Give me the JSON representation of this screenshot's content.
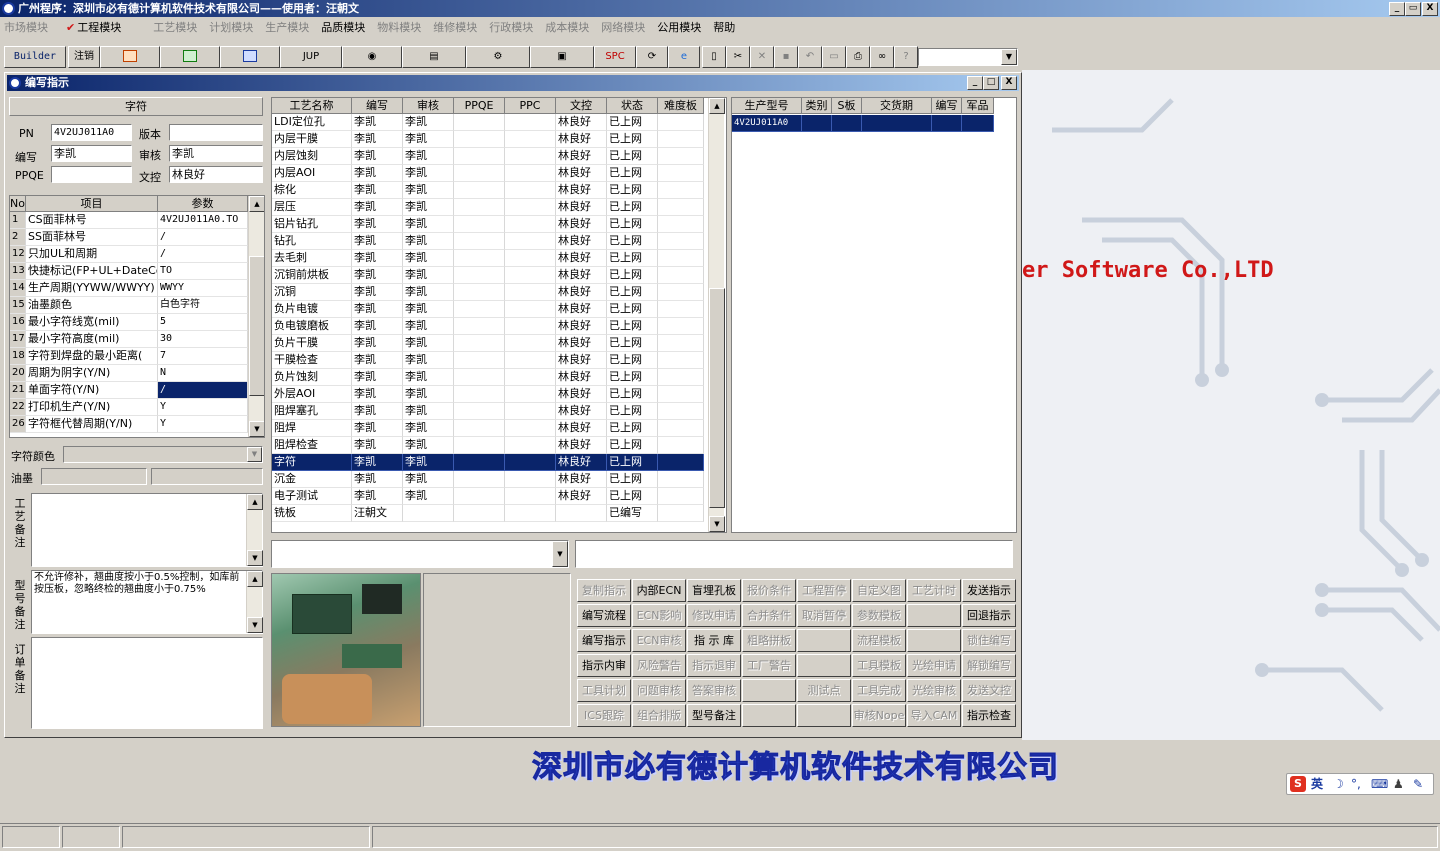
{
  "app": {
    "title": "广州程序：深圳市必有德计算机软件技术有限公司——使用者：汪朝文",
    "window_controls": [
      "_",
      "▭",
      "X"
    ]
  },
  "menu": [
    "市场模块",
    "工程模块",
    "工艺模块",
    "计划模块",
    "生产模块",
    "品质模块",
    "物料模块",
    "维修模块",
    "行政模块",
    "成本模块",
    "网络模块",
    "公用模块",
    "帮助"
  ],
  "toolbar": {
    "builder": "Builder",
    "logout": "注销",
    "jup": "JUP",
    "spc": "SPC"
  },
  "window": {
    "title": "编写指示",
    "controls": [
      "_",
      "□",
      "X"
    ]
  },
  "form": {
    "section_title": "字符",
    "pn_label": "PN",
    "pn_value": "4V2UJ011A0",
    "version_label": "版本",
    "version_value": "",
    "writer_label": "编写",
    "writer_value": "李凯",
    "reviewer_label": "审核",
    "reviewer_value": "李凯",
    "ppqe_label": "PPQE",
    "ppqe_value": "",
    "doc_label": "文控",
    "doc_value": "林良好"
  },
  "param_table": {
    "headers": [
      "No",
      "项目",
      "参数"
    ],
    "rows": [
      {
        "no": "1",
        "item": "CS面菲林号",
        "value": "4V2UJ011A0.TO"
      },
      {
        "no": "2",
        "item": "SS面菲林号",
        "value": "/"
      },
      {
        "no": "12",
        "item": "只加UL和周期",
        "value": "/"
      },
      {
        "no": "13",
        "item": "快捷标记(FP+UL+DateCo",
        "value": "TO"
      },
      {
        "no": "14",
        "item": "生产周期(YYWW/WWYY)",
        "value": "WWYY"
      },
      {
        "no": "15",
        "item": "油墨颜色",
        "value": "白色字符"
      },
      {
        "no": "16",
        "item": "最小字符线宽(mil)",
        "value": "5"
      },
      {
        "no": "17",
        "item": "最小字符高度(mil)",
        "value": "30"
      },
      {
        "no": "18",
        "item": "字符到焊盘的最小距离(",
        "value": "7"
      },
      {
        "no": "20",
        "item": "周期为阴字(Y/N)",
        "value": "N"
      },
      {
        "no": "21",
        "item": "单面字符(Y/N)",
        "value": "/"
      },
      {
        "no": "22",
        "item": "打印机生产(Y/N)",
        "value": "Y"
      },
      {
        "no": "26",
        "item": "字符框代替周期(Y/N)",
        "value": "Y"
      }
    ]
  },
  "char_color_label": "字符颜色",
  "ink_label": "油墨",
  "process_note_label": "工艺备注",
  "model_note_label": "型号备注",
  "model_note_text": "不允许修补，翘曲度按小于0.5%控制，如库前按压板，忽略终检的翘曲度小于0.75%",
  "order_note_label": "订单备注",
  "process_table": {
    "headers": [
      "工艺名称",
      "编写",
      "审核",
      "PPQE",
      "PPC",
      "文控",
      "状态",
      "难度板"
    ],
    "rows": [
      {
        "name": "LDI定位孔",
        "writer": "李凯",
        "reviewer": "李凯",
        "doc": "林良好",
        "status": "已上网"
      },
      {
        "name": "内层干膜",
        "writer": "李凯",
        "reviewer": "李凯",
        "doc": "林良好",
        "status": "已上网"
      },
      {
        "name": "内层蚀刻",
        "writer": "李凯",
        "reviewer": "李凯",
        "doc": "林良好",
        "status": "已上网"
      },
      {
        "name": "内层AOI",
        "writer": "李凯",
        "reviewer": "李凯",
        "doc": "林良好",
        "status": "已上网"
      },
      {
        "name": "棕化",
        "writer": "李凯",
        "reviewer": "李凯",
        "doc": "林良好",
        "status": "已上网"
      },
      {
        "name": "层压",
        "writer": "李凯",
        "reviewer": "李凯",
        "doc": "林良好",
        "status": "已上网"
      },
      {
        "name": "铝片钻孔",
        "writer": "李凯",
        "reviewer": "李凯",
        "doc": "林良好",
        "status": "已上网"
      },
      {
        "name": "钻孔",
        "writer": "李凯",
        "reviewer": "李凯",
        "doc": "林良好",
        "status": "已上网"
      },
      {
        "name": "去毛刺",
        "writer": "李凯",
        "reviewer": "李凯",
        "doc": "林良好",
        "status": "已上网"
      },
      {
        "name": "沉铜前烘板",
        "writer": "李凯",
        "reviewer": "李凯",
        "doc": "林良好",
        "status": "已上网"
      },
      {
        "name": "沉铜",
        "writer": "李凯",
        "reviewer": "李凯",
        "doc": "林良好",
        "status": "已上网"
      },
      {
        "name": "负片电镀",
        "writer": "李凯",
        "reviewer": "李凯",
        "doc": "林良好",
        "status": "已上网"
      },
      {
        "name": "负电镀磨板",
        "writer": "李凯",
        "reviewer": "李凯",
        "doc": "林良好",
        "status": "已上网"
      },
      {
        "name": "负片干膜",
        "writer": "李凯",
        "reviewer": "李凯",
        "doc": "林良好",
        "status": "已上网"
      },
      {
        "name": "干膜检查",
        "writer": "李凯",
        "reviewer": "李凯",
        "doc": "林良好",
        "status": "已上网"
      },
      {
        "name": "负片蚀刻",
        "writer": "李凯",
        "reviewer": "李凯",
        "doc": "林良好",
        "status": "已上网"
      },
      {
        "name": "外层AOI",
        "writer": "李凯",
        "reviewer": "李凯",
        "doc": "林良好",
        "status": "已上网"
      },
      {
        "name": "阻焊塞孔",
        "writer": "李凯",
        "reviewer": "李凯",
        "doc": "林良好",
        "status": "已上网"
      },
      {
        "name": "阻焊",
        "writer": "李凯",
        "reviewer": "李凯",
        "doc": "林良好",
        "status": "已上网"
      },
      {
        "name": "阻焊检查",
        "writer": "李凯",
        "reviewer": "李凯",
        "doc": "林良好",
        "status": "已上网"
      },
      {
        "name": "字符",
        "writer": "李凯",
        "reviewer": "李凯",
        "doc": "林良好",
        "status": "已上网"
      },
      {
        "name": "沉金",
        "writer": "李凯",
        "reviewer": "李凯",
        "doc": "林良好",
        "status": "已上网"
      },
      {
        "name": "电子测试",
        "writer": "李凯",
        "reviewer": "李凯",
        "doc": "林良好",
        "status": "已上网"
      },
      {
        "name": "铣板",
        "writer": "汪朝文",
        "reviewer": "",
        "doc": "",
        "status": "已编写"
      }
    ]
  },
  "model_table": {
    "headers": [
      "生产型号",
      "类别",
      "S板",
      "交货期",
      "编写",
      "军品"
    ],
    "rows": [
      {
        "model": "4V2UJ011A0"
      }
    ]
  },
  "buttons": [
    {
      "label": "复制指示",
      "enabled": false
    },
    {
      "label": "内部ECN",
      "enabled": true
    },
    {
      "label": "盲埋孔板",
      "enabled": true
    },
    {
      "label": "报价条件",
      "enabled": false
    },
    {
      "label": "工程暂停",
      "enabled": false
    },
    {
      "label": "自定义图",
      "enabled": false
    },
    {
      "label": "工艺计时",
      "enabled": false
    },
    {
      "label": "发送指示",
      "enabled": true
    },
    {
      "label": "编写流程",
      "enabled": true
    },
    {
      "label": "ECN影响",
      "enabled": false
    },
    {
      "label": "修改申请",
      "enabled": false
    },
    {
      "label": "合并条件",
      "enabled": false
    },
    {
      "label": "取消暂停",
      "enabled": false
    },
    {
      "label": "参数模板",
      "enabled": false
    },
    {
      "label": "",
      "enabled": false
    },
    {
      "label": "回退指示",
      "enabled": true
    },
    {
      "label": "编写指示",
      "enabled": true
    },
    {
      "label": "ECN审核",
      "enabled": false
    },
    {
      "label": "指 示 库",
      "enabled": true
    },
    {
      "label": "粗略拼板",
      "enabled": false
    },
    {
      "label": "",
      "enabled": false
    },
    {
      "label": "流程模板",
      "enabled": false
    },
    {
      "label": "",
      "enabled": false
    },
    {
      "label": "锁住编写",
      "enabled": false
    },
    {
      "label": "指示内审",
      "enabled": true
    },
    {
      "label": "风险警告",
      "enabled": false
    },
    {
      "label": "指示退审",
      "enabled": false
    },
    {
      "label": "工厂警告",
      "enabled": false
    },
    {
      "label": "",
      "enabled": false
    },
    {
      "label": "工具模板",
      "enabled": false
    },
    {
      "label": "光绘申请",
      "enabled": false
    },
    {
      "label": "解锁编写",
      "enabled": false
    },
    {
      "label": "工具计划",
      "enabled": false
    },
    {
      "label": "问题审核",
      "enabled": false
    },
    {
      "label": "答案审核",
      "enabled": false
    },
    {
      "label": "",
      "enabled": false
    },
    {
      "label": "测试点",
      "enabled": false
    },
    {
      "label": "工具完成",
      "enabled": false
    },
    {
      "label": "光绘审核",
      "enabled": false
    },
    {
      "label": "发送文控",
      "enabled": false
    },
    {
      "label": "ICS跟踪",
      "enabled": false
    },
    {
      "label": "组合排版",
      "enabled": false
    },
    {
      "label": "型号备注",
      "enabled": true
    },
    {
      "label": "",
      "enabled": false
    },
    {
      "label": "",
      "enabled": false
    },
    {
      "label": "审核Nope",
      "enabled": false
    },
    {
      "label": "导入CAM",
      "enabled": false
    },
    {
      "label": "指示检查",
      "enabled": true
    }
  ],
  "background": {
    "company_en": "er Software Co.,LTD",
    "company_cn": "深圳市必有德计算机软件技术有限公司"
  },
  "ime": {
    "lang": "英"
  },
  "colors": {
    "title_bar": "#0a246a",
    "selection": "#0a246a",
    "face": "#d4d0c8",
    "company_en": "#d01818",
    "company_cn": "#3050d8"
  }
}
